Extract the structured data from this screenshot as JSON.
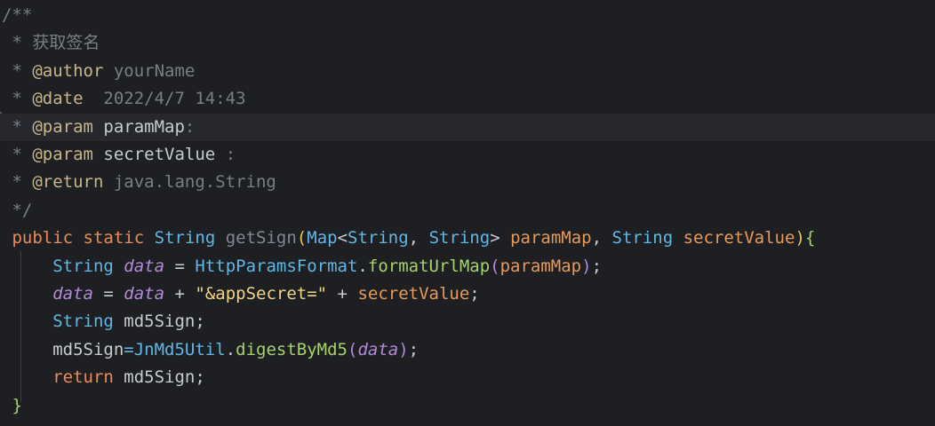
{
  "colors": {
    "background": "#1e1f22",
    "current_line": "#26282e",
    "comment": "#7a7e85",
    "doc_tag": "#c9b68b",
    "keyword": "#e98c59",
    "type": "#5fb8e6",
    "method_name": "#7f8a96",
    "method_call": "#a6d36b",
    "field_italic": "#b58ad8",
    "string": "#f2d486",
    "text": "#c8cbd0",
    "brace": "#a6d36b",
    "paren_yellow": "#e5c75a",
    "paren_purple": "#b58ad8",
    "param": "#e79a56"
  },
  "lines": [
    {
      "tokens": [
        {
          "t": "/**",
          "c": "comment"
        }
      ]
    },
    {
      "tokens": [
        {
          "t": " * ",
          "c": "comment"
        },
        {
          "t": "获取签名",
          "c": "comment"
        }
      ]
    },
    {
      "tokens": [
        {
          "t": " * ",
          "c": "comment"
        },
        {
          "t": "@author",
          "c": "doc_tag"
        },
        {
          "t": " yourName",
          "c": "comment"
        }
      ]
    },
    {
      "tokens": [
        {
          "t": " * ",
          "c": "comment"
        },
        {
          "t": "@date",
          "c": "doc_tag"
        },
        {
          "t": "  2022/4/7 14:43",
          "c": "comment"
        }
      ]
    },
    {
      "current": true,
      "tokens": [
        {
          "t": " * ",
          "c": "comment"
        },
        {
          "t": "@param",
          "c": "doc_tag"
        },
        {
          "t": " paramMap",
          "c": "text"
        },
        {
          "t": ":",
          "c": "comment"
        }
      ]
    },
    {
      "tokens": [
        {
          "t": " * ",
          "c": "comment"
        },
        {
          "t": "@param",
          "c": "doc_tag"
        },
        {
          "t": " secretValue",
          "c": "text"
        },
        {
          "t": " :",
          "c": "comment"
        }
      ]
    },
    {
      "tokens": [
        {
          "t": " * ",
          "c": "comment"
        },
        {
          "t": "@return",
          "c": "doc_tag"
        },
        {
          "t": " java.lang.String",
          "c": "comment"
        }
      ]
    },
    {
      "tokens": [
        {
          "t": " */",
          "c": "comment"
        }
      ]
    },
    {
      "tokens": [
        {
          "t": " public",
          "c": "keyword"
        },
        {
          "t": " ",
          "c": "text"
        },
        {
          "t": "static",
          "c": "keyword"
        },
        {
          "t": " ",
          "c": "text"
        },
        {
          "t": "String",
          "c": "type"
        },
        {
          "t": " ",
          "c": "text"
        },
        {
          "t": "getSign",
          "c": "method_name"
        },
        {
          "t": "(",
          "c": "paren_yellow"
        },
        {
          "t": "Map",
          "c": "type"
        },
        {
          "t": "<",
          "c": "text"
        },
        {
          "t": "String",
          "c": "type"
        },
        {
          "t": ", ",
          "c": "text"
        },
        {
          "t": "String",
          "c": "type"
        },
        {
          "t": "> ",
          "c": "text"
        },
        {
          "t": "paramMap",
          "c": "param"
        },
        {
          "t": ", ",
          "c": "text"
        },
        {
          "t": "String",
          "c": "type"
        },
        {
          "t": " ",
          "c": "text"
        },
        {
          "t": "secretValue",
          "c": "param"
        },
        {
          "t": ")",
          "c": "paren_yellow"
        },
        {
          "t": "{",
          "c": "brace"
        }
      ]
    },
    {
      "tokens": [
        {
          "t": "     String",
          "c": "type"
        },
        {
          "t": " ",
          "c": "text"
        },
        {
          "t": "data",
          "c": "field_italic",
          "i": true
        },
        {
          "t": " = ",
          "c": "text"
        },
        {
          "t": "HttpParamsFormat",
          "c": "type"
        },
        {
          "t": ".",
          "c": "text"
        },
        {
          "t": "formatUrlMap",
          "c": "method_call"
        },
        {
          "t": "(",
          "c": "paren_purple"
        },
        {
          "t": "paramMap",
          "c": "param"
        },
        {
          "t": ")",
          "c": "paren_purple"
        },
        {
          "t": ";",
          "c": "text"
        }
      ]
    },
    {
      "tokens": [
        {
          "t": "     ",
          "c": "text"
        },
        {
          "t": "data",
          "c": "field_italic",
          "i": true
        },
        {
          "t": " = ",
          "c": "text"
        },
        {
          "t": "data",
          "c": "field_italic",
          "i": true
        },
        {
          "t": " + ",
          "c": "text"
        },
        {
          "t": "\"&appSecret=\"",
          "c": "string"
        },
        {
          "t": " + ",
          "c": "text"
        },
        {
          "t": "secretValue",
          "c": "param"
        },
        {
          "t": ";",
          "c": "text"
        }
      ]
    },
    {
      "tokens": [
        {
          "t": "     String",
          "c": "type"
        },
        {
          "t": " md5Sign;",
          "c": "text"
        }
      ]
    },
    {
      "tokens": [
        {
          "t": "     md5Sign",
          "c": "text"
        },
        {
          "t": "=",
          "c": "type"
        },
        {
          "t": "JnMd5Util",
          "c": "type"
        },
        {
          "t": ".",
          "c": "text"
        },
        {
          "t": "digestByMd5",
          "c": "method_call"
        },
        {
          "t": "(",
          "c": "paren_purple"
        },
        {
          "t": "data",
          "c": "field_italic",
          "i": true
        },
        {
          "t": ")",
          "c": "paren_purple"
        },
        {
          "t": ";",
          "c": "text"
        }
      ]
    },
    {
      "tokens": [
        {
          "t": "     return",
          "c": "keyword"
        },
        {
          "t": " md5Sign;",
          "c": "text"
        }
      ]
    },
    {
      "tokens": [
        {
          "t": " }",
          "c": "brace"
        }
      ]
    }
  ]
}
